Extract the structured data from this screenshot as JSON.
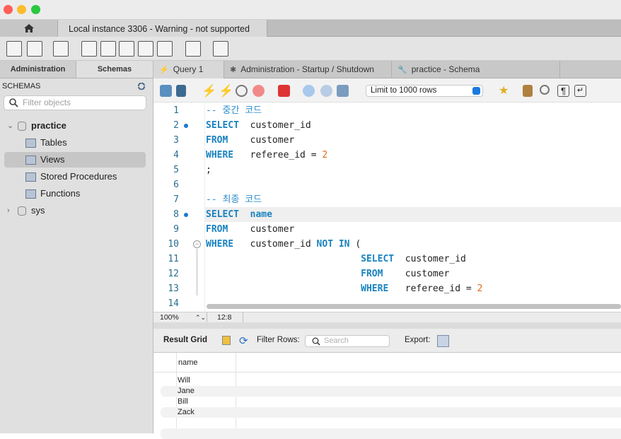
{
  "window": {
    "traffic_lights": {
      "close": "#fe5f57",
      "minimize": "#febc2e",
      "zoom": "#28c840"
    }
  },
  "connection_tabs": {
    "home_icon": "home-icon",
    "active": "Local instance 3306 - Warning - not supported"
  },
  "main_toolbar": {
    "icons": [
      "new-sql-tab-icon",
      "open-sql-script-icon",
      "inspector-icon",
      "create-schema-icon",
      "create-table-icon",
      "create-view-icon",
      "create-procedure-icon",
      "create-function-icon",
      "search-table-data-icon",
      "reconnect-icon"
    ]
  },
  "sidebar": {
    "tabs": [
      "Administration",
      "Schemas"
    ],
    "active_tab": "Schemas",
    "header": "SCHEMAS",
    "filter_placeholder": "Filter objects",
    "schemas": [
      {
        "name": "practice",
        "expanded": true,
        "children": [
          "Tables",
          "Views",
          "Stored Procedures",
          "Functions"
        ],
        "selected_child": "Views"
      },
      {
        "name": "sys",
        "expanded": false
      }
    ]
  },
  "editor_tabs": [
    {
      "label": "Query 1",
      "icon": "lightning-icon",
      "active": true
    },
    {
      "label": "Administration - Startup / Shutdown",
      "icon": "puzzle-icon"
    },
    {
      "label": "practice - Schema",
      "icon": "wrench-icon"
    }
  ],
  "editor_toolbar": {
    "limit_select": "Limit to 1000 rows"
  },
  "editor": {
    "lines": [
      {
        "n": "1",
        "tokens": [
          {
            "t": "cm",
            "v": "-- 중간 코드"
          }
        ]
      },
      {
        "n": "2",
        "dot": true,
        "tokens": [
          {
            "t": "kw",
            "v": "SELECT"
          },
          {
            "t": "tx",
            "v": "  customer_id"
          }
        ]
      },
      {
        "n": "3",
        "tokens": [
          {
            "t": "kw",
            "v": "FROM"
          },
          {
            "t": "tx",
            "v": "    customer"
          }
        ]
      },
      {
        "n": "4",
        "tokens": [
          {
            "t": "kw",
            "v": "WHERE"
          },
          {
            "t": "tx",
            "v": "   referee_id = "
          },
          {
            "t": "num",
            "v": "2"
          }
        ]
      },
      {
        "n": "5",
        "tokens": [
          {
            "t": "tx",
            "v": ";"
          }
        ]
      },
      {
        "n": "6",
        "tokens": []
      },
      {
        "n": "7",
        "tokens": [
          {
            "t": "cm",
            "v": "-- 최종 코드"
          }
        ]
      },
      {
        "n": "8",
        "dot": true,
        "current": true,
        "tokens": [
          {
            "t": "kw",
            "v": "SELECT"
          },
          {
            "t": "tx",
            "v": "  "
          },
          {
            "t": "kw",
            "v": "name"
          }
        ]
      },
      {
        "n": "9",
        "tokens": [
          {
            "t": "kw",
            "v": "FROM"
          },
          {
            "t": "tx",
            "v": "    customer"
          }
        ]
      },
      {
        "n": "10",
        "fold": true,
        "tokens": [
          {
            "t": "kw",
            "v": "WHERE"
          },
          {
            "t": "tx",
            "v": "   customer_id "
          },
          {
            "t": "kw",
            "v": "NOT IN"
          },
          {
            "t": "tx",
            "v": " ("
          }
        ]
      },
      {
        "n": "11",
        "tokens": [
          {
            "t": "tx",
            "v": "                            "
          },
          {
            "t": "kw",
            "v": "SELECT"
          },
          {
            "t": "tx",
            "v": "  customer_id"
          }
        ]
      },
      {
        "n": "12",
        "tokens": [
          {
            "t": "tx",
            "v": "                            "
          },
          {
            "t": "kw",
            "v": "FROM"
          },
          {
            "t": "tx",
            "v": "    customer"
          }
        ]
      },
      {
        "n": "13",
        "tokens": [
          {
            "t": "tx",
            "v": "                            "
          },
          {
            "t": "kw",
            "v": "WHERE"
          },
          {
            "t": "tx",
            "v": "   referee_id = "
          },
          {
            "t": "num",
            "v": "2"
          }
        ]
      },
      {
        "n": "14",
        "tokens": []
      }
    ]
  },
  "status": {
    "zoom": "100%",
    "cursor": "12:8"
  },
  "result": {
    "title": "Result Grid",
    "filter_label": "Filter Rows:",
    "search_placeholder": "Search",
    "export_label": "Export:",
    "columns": [
      "name"
    ],
    "rows": [
      [
        "Will"
      ],
      [
        "Jane"
      ],
      [
        "Bill"
      ],
      [
        "Zack"
      ]
    ]
  }
}
